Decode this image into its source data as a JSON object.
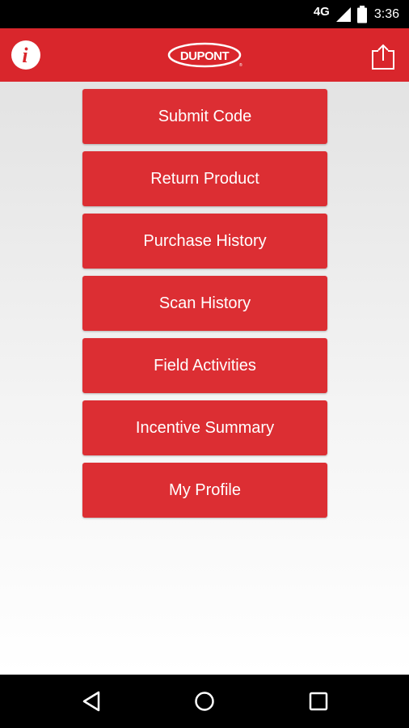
{
  "status_bar": {
    "network_label": "4G",
    "time": "3:36",
    "icons": [
      "signal-icon",
      "battery-icon"
    ]
  },
  "app_bar": {
    "info_icon": "info-icon",
    "info_glyph": "i",
    "logo_text": "DUPONT",
    "share_icon": "upload-icon"
  },
  "menu": {
    "items": [
      {
        "label": "Submit Code"
      },
      {
        "label": "Return Product"
      },
      {
        "label": "Purchase History"
      },
      {
        "label": "Scan History"
      },
      {
        "label": "Field Activities"
      },
      {
        "label": "Incentive Summary"
      },
      {
        "label": "My Profile"
      }
    ]
  },
  "nav_bar": {
    "icons": [
      "back-icon",
      "home-icon",
      "recent-apps-icon"
    ]
  },
  "colors": {
    "brand_red": "#d9262c",
    "button_red": "#dc2e33",
    "text_on_red": "#ffffff",
    "system_bar": "#000000"
  }
}
